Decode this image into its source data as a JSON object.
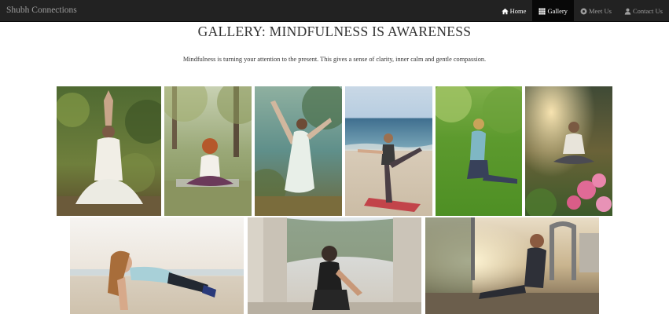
{
  "navbar": {
    "brand": "Shubh Connections",
    "items": [
      {
        "label": "Home",
        "icon": "home-icon",
        "state": "current"
      },
      {
        "label": "Gallery",
        "icon": "grid-icon",
        "state": "active"
      },
      {
        "label": "Meet Us",
        "icon": "circle-info-icon",
        "state": "default"
      },
      {
        "label": "Contact Us",
        "icon": "user-icon",
        "state": "default"
      }
    ]
  },
  "page": {
    "title": "GALLERY: MINDFULNESS IS AWARENESS",
    "lead": "Mindfulness is turning your attention to the present. This gives a sense of clarity, inner calm and gentle compassion."
  },
  "gallery": {
    "row1": [
      {
        "subject": "woman meditating with hands raised in forest"
      },
      {
        "subject": "red-haired woman meditating on mat in park"
      },
      {
        "subject": "woman in dancer yoga pose by the sea"
      },
      {
        "subject": "woman in standing leg stretch on beach"
      },
      {
        "subject": "woman in low lunge on grass"
      },
      {
        "subject": "woman meditating among pink flowers"
      }
    ],
    "row2": [
      {
        "subject": "smiling woman in plank pose on beach"
      },
      {
        "subject": "woman stretching among stone columns"
      },
      {
        "subject": "man stretching at outdoor gym at sunset"
      }
    ]
  },
  "colors": {
    "navbar_bg": "#222222",
    "navbar_text": "#9d9d9d",
    "navbar_active_bg": "#080808",
    "text": "#333333"
  }
}
